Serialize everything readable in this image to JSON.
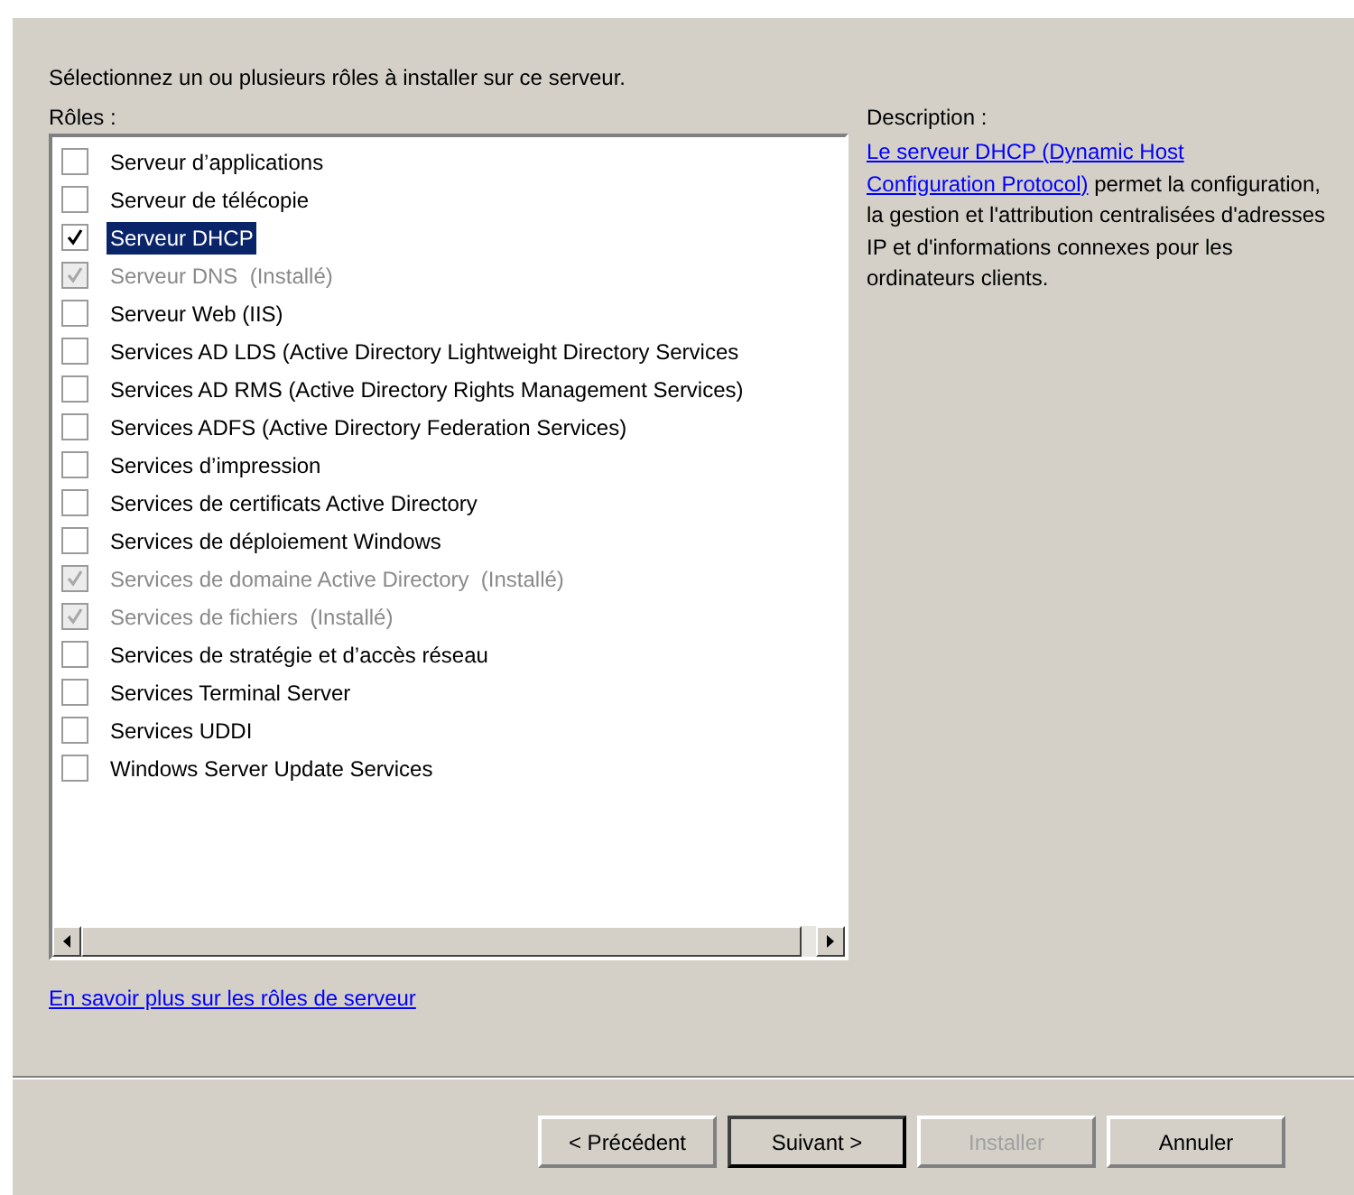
{
  "instruction": "Sélectionnez un ou plusieurs rôles à installer sur ce serveur.",
  "roles_label": "Rôles :",
  "roles": [
    {
      "label": "Serveur d’applications",
      "checked": false,
      "disabled": false,
      "selected": false
    },
    {
      "label": "Serveur de télécopie",
      "checked": false,
      "disabled": false,
      "selected": false
    },
    {
      "label": "Serveur DHCP",
      "checked": true,
      "disabled": false,
      "selected": true
    },
    {
      "label": "Serveur DNS  (Installé)",
      "checked": true,
      "disabled": true,
      "selected": false
    },
    {
      "label": "Serveur Web (IIS)",
      "checked": false,
      "disabled": false,
      "selected": false
    },
    {
      "label": "Services AD LDS (Active Directory Lightweight Directory Services",
      "checked": false,
      "disabled": false,
      "selected": false
    },
    {
      "label": "Services AD RMS (Active Directory Rights Management Services)",
      "checked": false,
      "disabled": false,
      "selected": false
    },
    {
      "label": "Services ADFS (Active Directory Federation Services)",
      "checked": false,
      "disabled": false,
      "selected": false
    },
    {
      "label": "Services d’impression",
      "checked": false,
      "disabled": false,
      "selected": false
    },
    {
      "label": "Services de certificats Active Directory",
      "checked": false,
      "disabled": false,
      "selected": false
    },
    {
      "label": "Services de déploiement Windows",
      "checked": false,
      "disabled": false,
      "selected": false
    },
    {
      "label": "Services de domaine Active Directory  (Installé)",
      "checked": true,
      "disabled": true,
      "selected": false
    },
    {
      "label": "Services de fichiers  (Installé)",
      "checked": true,
      "disabled": true,
      "selected": false
    },
    {
      "label": "Services de stratégie et d’accès réseau",
      "checked": false,
      "disabled": false,
      "selected": false
    },
    {
      "label": "Services Terminal Server",
      "checked": false,
      "disabled": false,
      "selected": false
    },
    {
      "label": "Services UDDI",
      "checked": false,
      "disabled": false,
      "selected": false
    },
    {
      "label": "Windows Server Update Services",
      "checked": false,
      "disabled": false,
      "selected": false
    }
  ],
  "description": {
    "label": "Description :",
    "link_lines": [
      "Le serveur DHCP (Dynamic Host",
      "Configuration Protocol)"
    ],
    "text": " permet la configuration, la gestion et l'attribution  centralisées  d'adresses IP et d'informations connexes pour les ordinateurs clients."
  },
  "more_link": "En savoir plus sur les rôles de serveur",
  "buttons": [
    {
      "label": "< Précédent",
      "disabled": false,
      "default": false
    },
    {
      "label": "Suivant >",
      "disabled": false,
      "default": true
    },
    {
      "label": "Installer",
      "disabled": true,
      "default": false
    },
    {
      "label": "Annuler",
      "disabled": false,
      "default": false
    }
  ]
}
